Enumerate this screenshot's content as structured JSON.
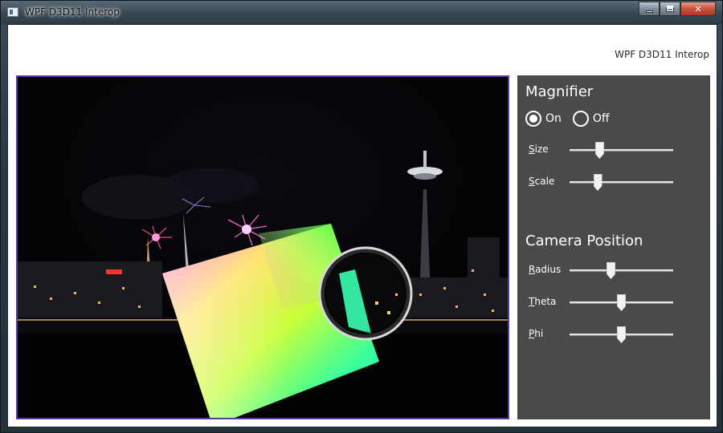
{
  "window": {
    "title": "WPF D3D11 Interop"
  },
  "header": {
    "label": "WPF D3D11 Interop"
  },
  "magnifier": {
    "title": "Magnifier",
    "radio_on": "On",
    "radio_off": "Off",
    "selected": "On",
    "sliders": [
      {
        "accel": "S",
        "rest": "ize",
        "value": 0.27
      },
      {
        "accel": "S",
        "rest": "cale",
        "value": 0.25
      }
    ]
  },
  "camera": {
    "title": "Camera Position",
    "sliders": [
      {
        "accel": "R",
        "rest": "adius",
        "value": 0.39
      },
      {
        "accel": "T",
        "rest": "heta",
        "value": 0.5
      },
      {
        "accel": "P",
        "rest": "hi",
        "value": 0.5
      }
    ]
  },
  "colors": {
    "viewport_border": "#5a3a9a",
    "panel_bg": "#4a4a4a"
  },
  "icons": {
    "app": "app-window-icon",
    "minimize": "minimize-icon",
    "maximize": "maximize-icon",
    "close": "close-icon"
  }
}
